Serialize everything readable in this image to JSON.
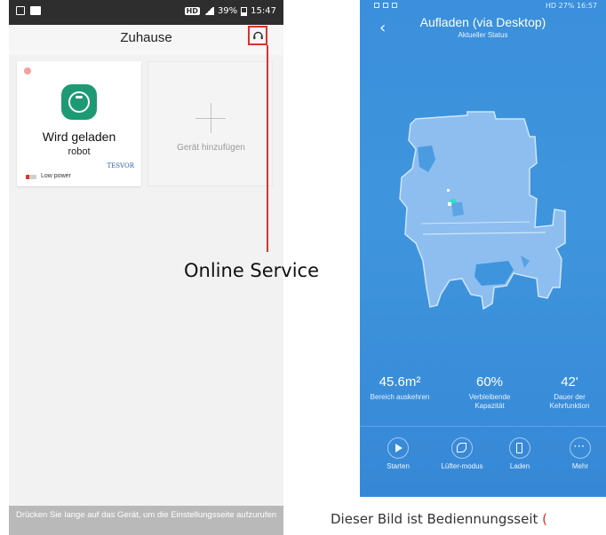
{
  "colors": {
    "accent_red": "#d8332b",
    "robot_green": "#1d9a74",
    "app_blue": "#3b8fdc"
  },
  "left_phone": {
    "status_bar": {
      "right_text": "39%",
      "time": "15:47",
      "hd": "HD"
    },
    "header": {
      "title": "Zuhause",
      "service_icon": "headset-icon"
    },
    "device_card": {
      "status": "Wird geladen",
      "name": "robot",
      "brand": "TESVOR",
      "battery_label": "Low power",
      "icon": "robot-vacuum-icon"
    },
    "add_device": {
      "label": "Gerät hinzufügen",
      "icon": "plus-icon"
    },
    "footer_hint": "Drücken Sie lange auf das Gerät, um die Einstellungsseite aufzurufen"
  },
  "annotation": {
    "label": "Online Service"
  },
  "right_phone": {
    "status_bar": {
      "text": "27%",
      "time": "16:57",
      "hd": "HD"
    },
    "title": "Aufladen (via Desktop)",
    "subtitle": "Aktueller Status",
    "stats": [
      {
        "value": "45.6m²",
        "label": "Bereich auskehren"
      },
      {
        "value": "60%",
        "label": "Verbleibende Kapazität"
      },
      {
        "value": "42'",
        "label": "Dauer der Kehrfunktion"
      }
    ],
    "buttons": [
      {
        "label": "Starten",
        "icon": "play-icon"
      },
      {
        "label": "Lüfter-modus",
        "icon": "fan-icon"
      },
      {
        "label": "Laden",
        "icon": "battery-icon"
      },
      {
        "label": "Mehr",
        "icon": "more-icon"
      }
    ]
  },
  "caption": {
    "text": "Dieser Bild ist Bediennungsseit",
    "paren": "("
  }
}
